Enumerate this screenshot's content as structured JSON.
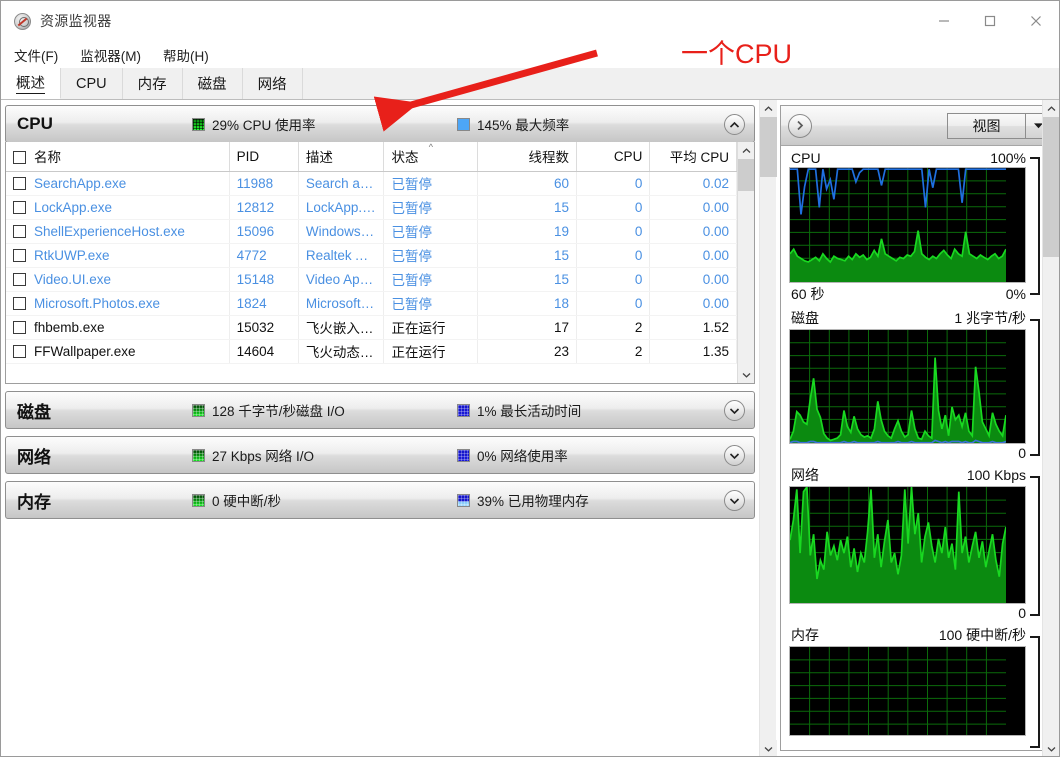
{
  "window": {
    "title": "资源监视器",
    "app_icon": "resource-monitor-icon",
    "controls": {
      "minimize": "minimize-icon",
      "maximize": "maximize-icon",
      "close": "close-icon"
    }
  },
  "menubar": {
    "items": [
      "文件(F)",
      "监视器(M)",
      "帮助(H)"
    ]
  },
  "tabs": [
    {
      "label": "概述",
      "active": true
    },
    {
      "label": "CPU",
      "active": false
    },
    {
      "label": "内存",
      "active": false
    },
    {
      "label": "磁盘",
      "active": false
    },
    {
      "label": "网络",
      "active": false
    }
  ],
  "sections": [
    {
      "title": "CPU",
      "expanded": true,
      "stat1": {
        "icon": "green-grid-icon",
        "text": "29% CPU 使用率"
      },
      "stat2": {
        "icon": "blue-square-icon",
        "text": "145% 最大频率"
      }
    },
    {
      "title": "磁盘",
      "expanded": false,
      "stat1": {
        "icon": "green-grid-icon",
        "text": "128 千字节/秒磁盘 I/O"
      },
      "stat2": {
        "icon": "blue-grid-icon",
        "text": "1% 最长活动时间"
      }
    },
    {
      "title": "网络",
      "expanded": false,
      "stat1": {
        "icon": "green-grid-icon",
        "text": "27 Kbps 网络 I/O"
      },
      "stat2": {
        "icon": "blue-grid-icon",
        "text": "0% 网络使用率"
      }
    },
    {
      "title": "内存",
      "expanded": false,
      "stat1": {
        "icon": "green-grid-icon",
        "text": "0 硬中断/秒"
      },
      "stat2": {
        "icon": "blue-grid-part-icon",
        "text": "39% 已用物理内存"
      }
    }
  ],
  "process_table": {
    "columns": [
      {
        "label": "名称",
        "align": "left"
      },
      {
        "label": "PID",
        "align": "left"
      },
      {
        "label": "描述",
        "align": "left"
      },
      {
        "label": "状态",
        "align": "left",
        "sorted": "asc"
      },
      {
        "label": "线程数",
        "align": "right"
      },
      {
        "label": "CPU",
        "align": "right"
      },
      {
        "label": "平均 CPU",
        "align": "right"
      }
    ],
    "rows": [
      {
        "name": "SearchApp.exe",
        "pid": "11988",
        "desc": "Search ap…",
        "status": "已暂停",
        "threads": "60",
        "cpu": "0",
        "avgcpu": "0.02",
        "suspended": true
      },
      {
        "name": "LockApp.exe",
        "pid": "12812",
        "desc": "LockApp.e…",
        "status": "已暂停",
        "threads": "15",
        "cpu": "0",
        "avgcpu": "0.00",
        "suspended": true
      },
      {
        "name": "ShellExperienceHost.exe",
        "pid": "15096",
        "desc": "Windows …",
        "status": "已暂停",
        "threads": "19",
        "cpu": "0",
        "avgcpu": "0.00",
        "suspended": true
      },
      {
        "name": "RtkUWP.exe",
        "pid": "4772",
        "desc": "Realtek A…",
        "status": "已暂停",
        "threads": "15",
        "cpu": "0",
        "avgcpu": "0.00",
        "suspended": true
      },
      {
        "name": "Video.UI.exe",
        "pid": "15148",
        "desc": "Video Ap…",
        "status": "已暂停",
        "threads": "15",
        "cpu": "0",
        "avgcpu": "0.00",
        "suspended": true
      },
      {
        "name": "Microsoft.Photos.exe",
        "pid": "1824",
        "desc": "Microsoft…",
        "status": "已暂停",
        "threads": "18",
        "cpu": "0",
        "avgcpu": "0.00",
        "suspended": true
      },
      {
        "name": "fhbemb.exe",
        "pid": "15032",
        "desc": "飞火嵌入…",
        "status": "正在运行",
        "threads": "17",
        "cpu": "2",
        "avgcpu": "1.52",
        "suspended": false
      },
      {
        "name": "FFWallpaper.exe",
        "pid": "14604",
        "desc": "飞火动态…",
        "status": "正在运行",
        "threads": "23",
        "cpu": "2",
        "avgcpu": "1.35",
        "suspended": false
      }
    ]
  },
  "right_panel": {
    "expand_button": "chevron-right-icon",
    "view_button": {
      "label": "视图",
      "arrow": "chevron-down-icon"
    },
    "graphs": [
      {
        "title": "CPU",
        "top_label": "100%",
        "bottom_left": "60 秒",
        "bottom_right": "0%"
      },
      {
        "title": "磁盘",
        "top_label": "1 兆字节/秒",
        "bottom_left": "",
        "bottom_right": "0"
      },
      {
        "title": "网络",
        "top_label": "100 Kbps",
        "bottom_left": "",
        "bottom_right": "0"
      },
      {
        "title": "内存",
        "top_label": "100 硬中断/秒",
        "bottom_left": "",
        "bottom_right": ""
      }
    ]
  },
  "annotation": {
    "text": "一个CPU",
    "color": "#e8201a",
    "arrow": "red-arrow-icon"
  },
  "chart_data": [
    {
      "type": "line",
      "title": "CPU",
      "ylabel": "%",
      "xlabel": "60 秒",
      "ylim": [
        0,
        100
      ],
      "grid": true,
      "series": [
        {
          "name": "最大频率",
          "color": "#1f6fe0",
          "values": [
            99,
            99,
            99,
            60,
            84,
            99,
            99,
            99,
            66,
            99,
            82,
            90,
            73,
            99,
            99,
            99,
            99,
            99,
            88,
            96,
            99,
            99,
            99,
            99,
            99,
            85,
            99,
            99,
            99,
            99,
            99,
            99,
            99,
            99,
            99,
            99,
            99,
            66,
            99,
            83,
            99,
            99,
            99,
            99,
            99,
            99,
            99,
            70,
            99,
            99,
            99,
            99,
            99,
            99,
            99,
            99,
            99,
            99,
            99,
            99
          ]
        },
        {
          "name": "CPU 使用率",
          "color": "#19d921",
          "fill": true,
          "values": [
            26,
            30,
            24,
            22,
            20,
            19,
            21,
            23,
            20,
            26,
            22,
            19,
            24,
            22,
            21,
            20,
            24,
            21,
            26,
            23,
            25,
            21,
            23,
            29,
            24,
            39,
            26,
            24,
            22,
            20,
            23,
            22,
            25,
            24,
            28,
            46,
            26,
            23,
            21,
            24,
            22,
            26,
            29,
            25,
            22,
            30,
            26,
            24,
            45,
            26,
            24,
            22,
            25,
            23,
            21,
            24,
            26,
            22,
            24,
            30
          ]
        }
      ]
    },
    {
      "type": "area",
      "title": "磁盘",
      "ylabel": "1 兆字节/秒",
      "ylim": [
        0,
        100
      ],
      "grid": true,
      "series": [
        {
          "name": "磁盘 I/O",
          "color": "#19d921",
          "fill": true,
          "values": [
            5,
            12,
            29,
            26,
            20,
            18,
            40,
            58,
            31,
            24,
            10,
            6,
            4,
            5,
            6,
            9,
            30,
            16,
            11,
            25,
            14,
            9,
            7,
            8,
            6,
            14,
            38,
            22,
            12,
            8,
            6,
            14,
            21,
            12,
            7,
            9,
            30,
            14,
            6,
            5,
            12,
            8,
            6,
            76,
            30,
            14,
            26,
            8,
            33,
            22,
            26,
            16,
            28,
            12,
            8,
            68,
            46,
            20,
            14,
            8,
            28,
            18,
            12,
            8,
            26
          ]
        },
        {
          "name": "最长活动时间",
          "color": "#3b6fd8",
          "fill": true,
          "values": [
            2,
            3,
            3,
            2,
            2,
            2,
            3,
            3,
            2,
            2,
            2,
            2,
            2,
            2,
            2,
            2,
            3,
            2,
            2,
            3,
            2,
            2,
            2,
            2,
            2,
            2,
            3,
            2,
            2,
            2,
            2,
            2,
            3,
            2,
            2,
            2,
            3,
            2,
            2,
            2,
            2,
            2,
            2,
            4,
            3,
            2,
            3,
            2,
            3,
            3,
            3,
            2,
            3,
            2,
            2,
            4,
            3,
            2,
            2,
            2,
            3,
            2,
            2,
            2,
            3
          ]
        }
      ]
    },
    {
      "type": "area",
      "title": "网络",
      "ylabel": "100 Kbps",
      "ylim": [
        0,
        100
      ],
      "grid": true,
      "series": [
        {
          "name": "网络 I/O",
          "color": "#19d921",
          "fill": true,
          "values": [
            55,
            72,
            98,
            44,
            96,
            100,
            42,
            60,
            22,
            38,
            30,
            62,
            42,
            50,
            38,
            55,
            44,
            58,
            32,
            48,
            28,
            44,
            36,
            62,
            98,
            40,
            60,
            32,
            54,
            72,
            36,
            44,
            26,
            42,
            98,
            52,
            100,
            60,
            78,
            36,
            58,
            70,
            50,
            36,
            56,
            44,
            66,
            40,
            52,
            30,
            96,
            44,
            58,
            36,
            50,
            62,
            40,
            54,
            32,
            46,
            60,
            38,
            24,
            52,
            66
          ]
        }
      ]
    },
    {
      "type": "area",
      "title": "内存",
      "ylabel": "100 硬中断/秒",
      "ylim": [
        0,
        100
      ],
      "grid": true,
      "series": [
        {
          "name": "硬中断/秒",
          "color": "#19d921",
          "fill": true,
          "values": [
            0,
            0,
            0,
            0,
            0,
            0,
            0,
            0,
            0,
            0,
            0,
            0,
            0,
            0,
            0,
            0,
            0,
            0,
            0,
            0,
            0,
            0,
            0,
            0,
            0,
            0,
            0,
            0,
            0,
            0,
            0,
            0,
            0,
            0,
            0,
            0,
            0,
            0,
            0,
            0
          ]
        }
      ]
    }
  ]
}
